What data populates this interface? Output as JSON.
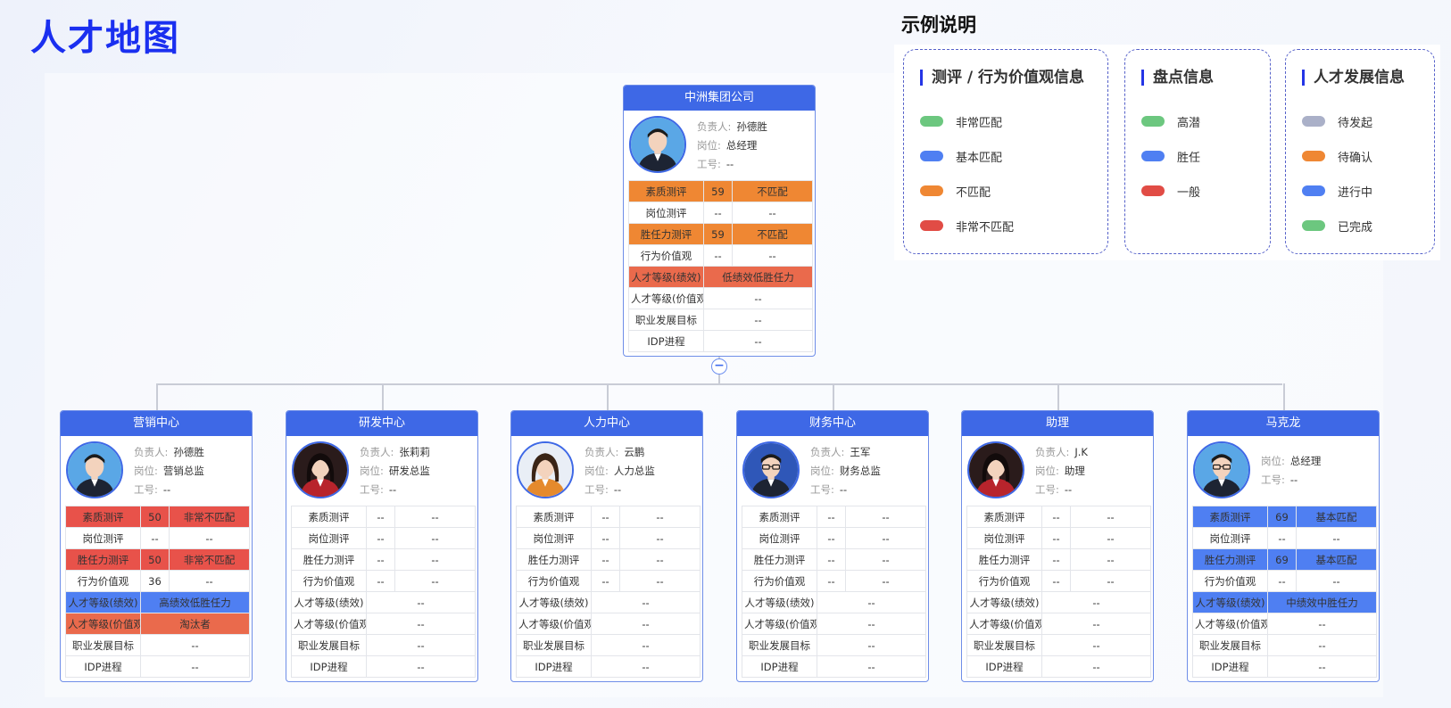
{
  "page_title": "人才地图",
  "legend": {
    "title": "示例说明",
    "groups": [
      {
        "title": "测评 / 行为价值观信息",
        "items": [
          {
            "label": "非常匹配",
            "color": "#6cc77f"
          },
          {
            "label": "基本匹配",
            "color": "#4f7ff2"
          },
          {
            "label": "不匹配",
            "color": "#ef8733"
          },
          {
            "label": "非常不匹配",
            "color": "#e14c45"
          }
        ]
      },
      {
        "title": "盘点信息",
        "items": [
          {
            "label": "高潜",
            "color": "#6cc77f"
          },
          {
            "label": "胜任",
            "color": "#4f7ff2"
          },
          {
            "label": "一般",
            "color": "#e14c45"
          }
        ]
      },
      {
        "title": "人才发展信息",
        "items": [
          {
            "label": "待发起",
            "color": "#aab0c8"
          },
          {
            "label": "待确认",
            "color": "#ef8733"
          },
          {
            "label": "进行中",
            "color": "#4f7ff2"
          },
          {
            "label": "已完成",
            "color": "#6cc77f"
          }
        ]
      }
    ]
  },
  "labels": {
    "manager": "负责人:",
    "position": "岗位:",
    "employee_id": "工号:"
  },
  "collapse_icon": "−",
  "root": {
    "name": "中洲集团公司",
    "manager": "孙德胜",
    "position": "总经理",
    "employee_id": "--",
    "avatar": "male",
    "rows": [
      {
        "label": "素质测评",
        "score": "59",
        "result": "不匹配",
        "color": "orange"
      },
      {
        "label": "岗位测评",
        "score": "--",
        "result": "--"
      },
      {
        "label": "胜任力测评",
        "score": "59",
        "result": "不匹配",
        "color": "orange"
      },
      {
        "label": "行为价值观",
        "score": "--",
        "result": "--"
      },
      {
        "label": "人才等级(绩效)",
        "result": "低绩效低胜任力",
        "color": "salmon"
      },
      {
        "label": "人才等级(价值观)",
        "result": "--"
      },
      {
        "label": "职业发展目标",
        "result": "--"
      },
      {
        "label": "IDP进程",
        "result": "--"
      }
    ]
  },
  "children": [
    {
      "name": "营销中心",
      "manager": "孙德胜",
      "position": "营销总监",
      "employee_id": "--",
      "avatar": "male",
      "rows": [
        {
          "label": "素质测评",
          "score": "50",
          "result": "非常不匹配",
          "color": "red"
        },
        {
          "label": "岗位测评",
          "score": "--",
          "result": "--"
        },
        {
          "label": "胜任力测评",
          "score": "50",
          "result": "非常不匹配",
          "color": "red"
        },
        {
          "label": "行为价值观",
          "score": "36",
          "result": "--"
        },
        {
          "label": "人才等级(绩效)",
          "result": "高绩效低胜任力",
          "color": "blue"
        },
        {
          "label": "人才等级(价值观)",
          "result": "淘汰者",
          "color": "salmon"
        },
        {
          "label": "职业发展目标",
          "result": "--"
        },
        {
          "label": "IDP进程",
          "result": "--"
        }
      ]
    },
    {
      "name": "研发中心",
      "manager": "张莉莉",
      "position": "研发总监",
      "employee_id": "--",
      "avatar": "female",
      "rows": [
        {
          "label": "素质测评",
          "score": "--",
          "result": "--"
        },
        {
          "label": "岗位测评",
          "score": "--",
          "result": "--"
        },
        {
          "label": "胜任力测评",
          "score": "--",
          "result": "--"
        },
        {
          "label": "行为价值观",
          "score": "--",
          "result": "--"
        },
        {
          "label": "人才等级(绩效)",
          "result": "--"
        },
        {
          "label": "人才等级(价值观)",
          "result": "--"
        },
        {
          "label": "职业发展目标",
          "result": "--"
        },
        {
          "label": "IDP进程",
          "result": "--"
        }
      ]
    },
    {
      "name": "人力中心",
      "manager": "云鹏",
      "position": "人力总监",
      "employee_id": "--",
      "avatar": "female2",
      "rows": [
        {
          "label": "素质测评",
          "score": "--",
          "result": "--"
        },
        {
          "label": "岗位测评",
          "score": "--",
          "result": "--"
        },
        {
          "label": "胜任力测评",
          "score": "--",
          "result": "--"
        },
        {
          "label": "行为价值观",
          "score": "--",
          "result": "--"
        },
        {
          "label": "人才等级(绩效)",
          "result": "--"
        },
        {
          "label": "人才等级(价值观)",
          "result": "--"
        },
        {
          "label": "职业发展目标",
          "result": "--"
        },
        {
          "label": "IDP进程",
          "result": "--"
        }
      ]
    },
    {
      "name": "财务中心",
      "manager": "王军",
      "position": "财务总监",
      "employee_id": "--",
      "avatar": "male_glasses",
      "rows": [
        {
          "label": "素质测评",
          "score": "--",
          "result": "--"
        },
        {
          "label": "岗位测评",
          "score": "--",
          "result": "--"
        },
        {
          "label": "胜任力测评",
          "score": "--",
          "result": "--"
        },
        {
          "label": "行为价值观",
          "score": "--",
          "result": "--"
        },
        {
          "label": "人才等级(绩效)",
          "result": "--"
        },
        {
          "label": "人才等级(价值观)",
          "result": "--"
        },
        {
          "label": "职业发展目标",
          "result": "--"
        },
        {
          "label": "IDP进程",
          "result": "--"
        }
      ]
    },
    {
      "name": "助理",
      "manager": "J.K",
      "position": "助理",
      "employee_id": "--",
      "avatar": "female",
      "rows": [
        {
          "label": "素质测评",
          "score": "--",
          "result": "--"
        },
        {
          "label": "岗位测评",
          "score": "--",
          "result": "--"
        },
        {
          "label": "胜任力测评",
          "score": "--",
          "result": "--"
        },
        {
          "label": "行为价值观",
          "score": "--",
          "result": "--"
        },
        {
          "label": "人才等级(绩效)",
          "result": "--"
        },
        {
          "label": "人才等级(价值观)",
          "result": "--"
        },
        {
          "label": "职业发展目标",
          "result": "--"
        },
        {
          "label": "IDP进程",
          "result": "--"
        }
      ]
    },
    {
      "name": "马克龙",
      "position": "总经理",
      "employee_id": "--",
      "avatar": "male_glasses2",
      "rows": [
        {
          "label": "素质测评",
          "score": "69",
          "result": "基本匹配",
          "color": "blue"
        },
        {
          "label": "岗位测评",
          "score": "--",
          "result": "--"
        },
        {
          "label": "胜任力测评",
          "score": "69",
          "result": "基本匹配",
          "color": "blue"
        },
        {
          "label": "行为价值观",
          "score": "--",
          "result": "--"
        },
        {
          "label": "人才等级(绩效)",
          "result": "中绩效中胜任力",
          "color": "blue"
        },
        {
          "label": "人才等级(价值观)",
          "result": "--"
        },
        {
          "label": "职业发展目标",
          "result": "--"
        },
        {
          "label": "IDP进程",
          "result": "--"
        }
      ]
    }
  ]
}
